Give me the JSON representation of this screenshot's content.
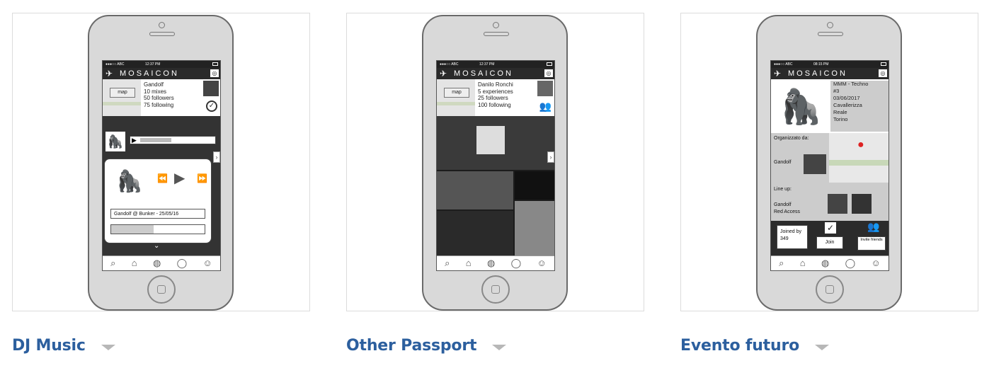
{
  "app": {
    "brand": "MOSAICON"
  },
  "cards": [
    {
      "caption": "DJ Music",
      "status": {
        "carrier": "●●●○○ ABC",
        "time": "12:37 PM"
      },
      "profile": {
        "map_label": "map",
        "lines": [
          "Gandolf",
          "10 mixes",
          "50 followers",
          "75 following"
        ]
      },
      "player": {
        "track": "Gandolf @ Bunker - 25/05/16"
      }
    },
    {
      "caption": "Other Passport",
      "status": {
        "carrier": "●●●○○ ABC",
        "time": "12:37 PM"
      },
      "profile": {
        "map_label": "map",
        "lines": [
          "Danilo Ronchi",
          "5 experiences",
          "25 followers",
          "100 following"
        ]
      }
    },
    {
      "caption": "Evento futuro",
      "status": {
        "carrier": "●●●○○ ABC",
        "time": "08:15 PM"
      },
      "event": {
        "info": [
          "MMM - Techno",
          "#3",
          "03/06/2017",
          "Cavallerizza",
          "Reale",
          "Torino"
        ],
        "organized_label": "Organizzato da:",
        "organizer": "Gandolf",
        "lineup_label": "Line up:",
        "lineup": [
          "Gandolf",
          "Red Access"
        ],
        "joined": "Joined by 349",
        "join_label": "Join",
        "invite_label": "Invite friends"
      }
    }
  ]
}
